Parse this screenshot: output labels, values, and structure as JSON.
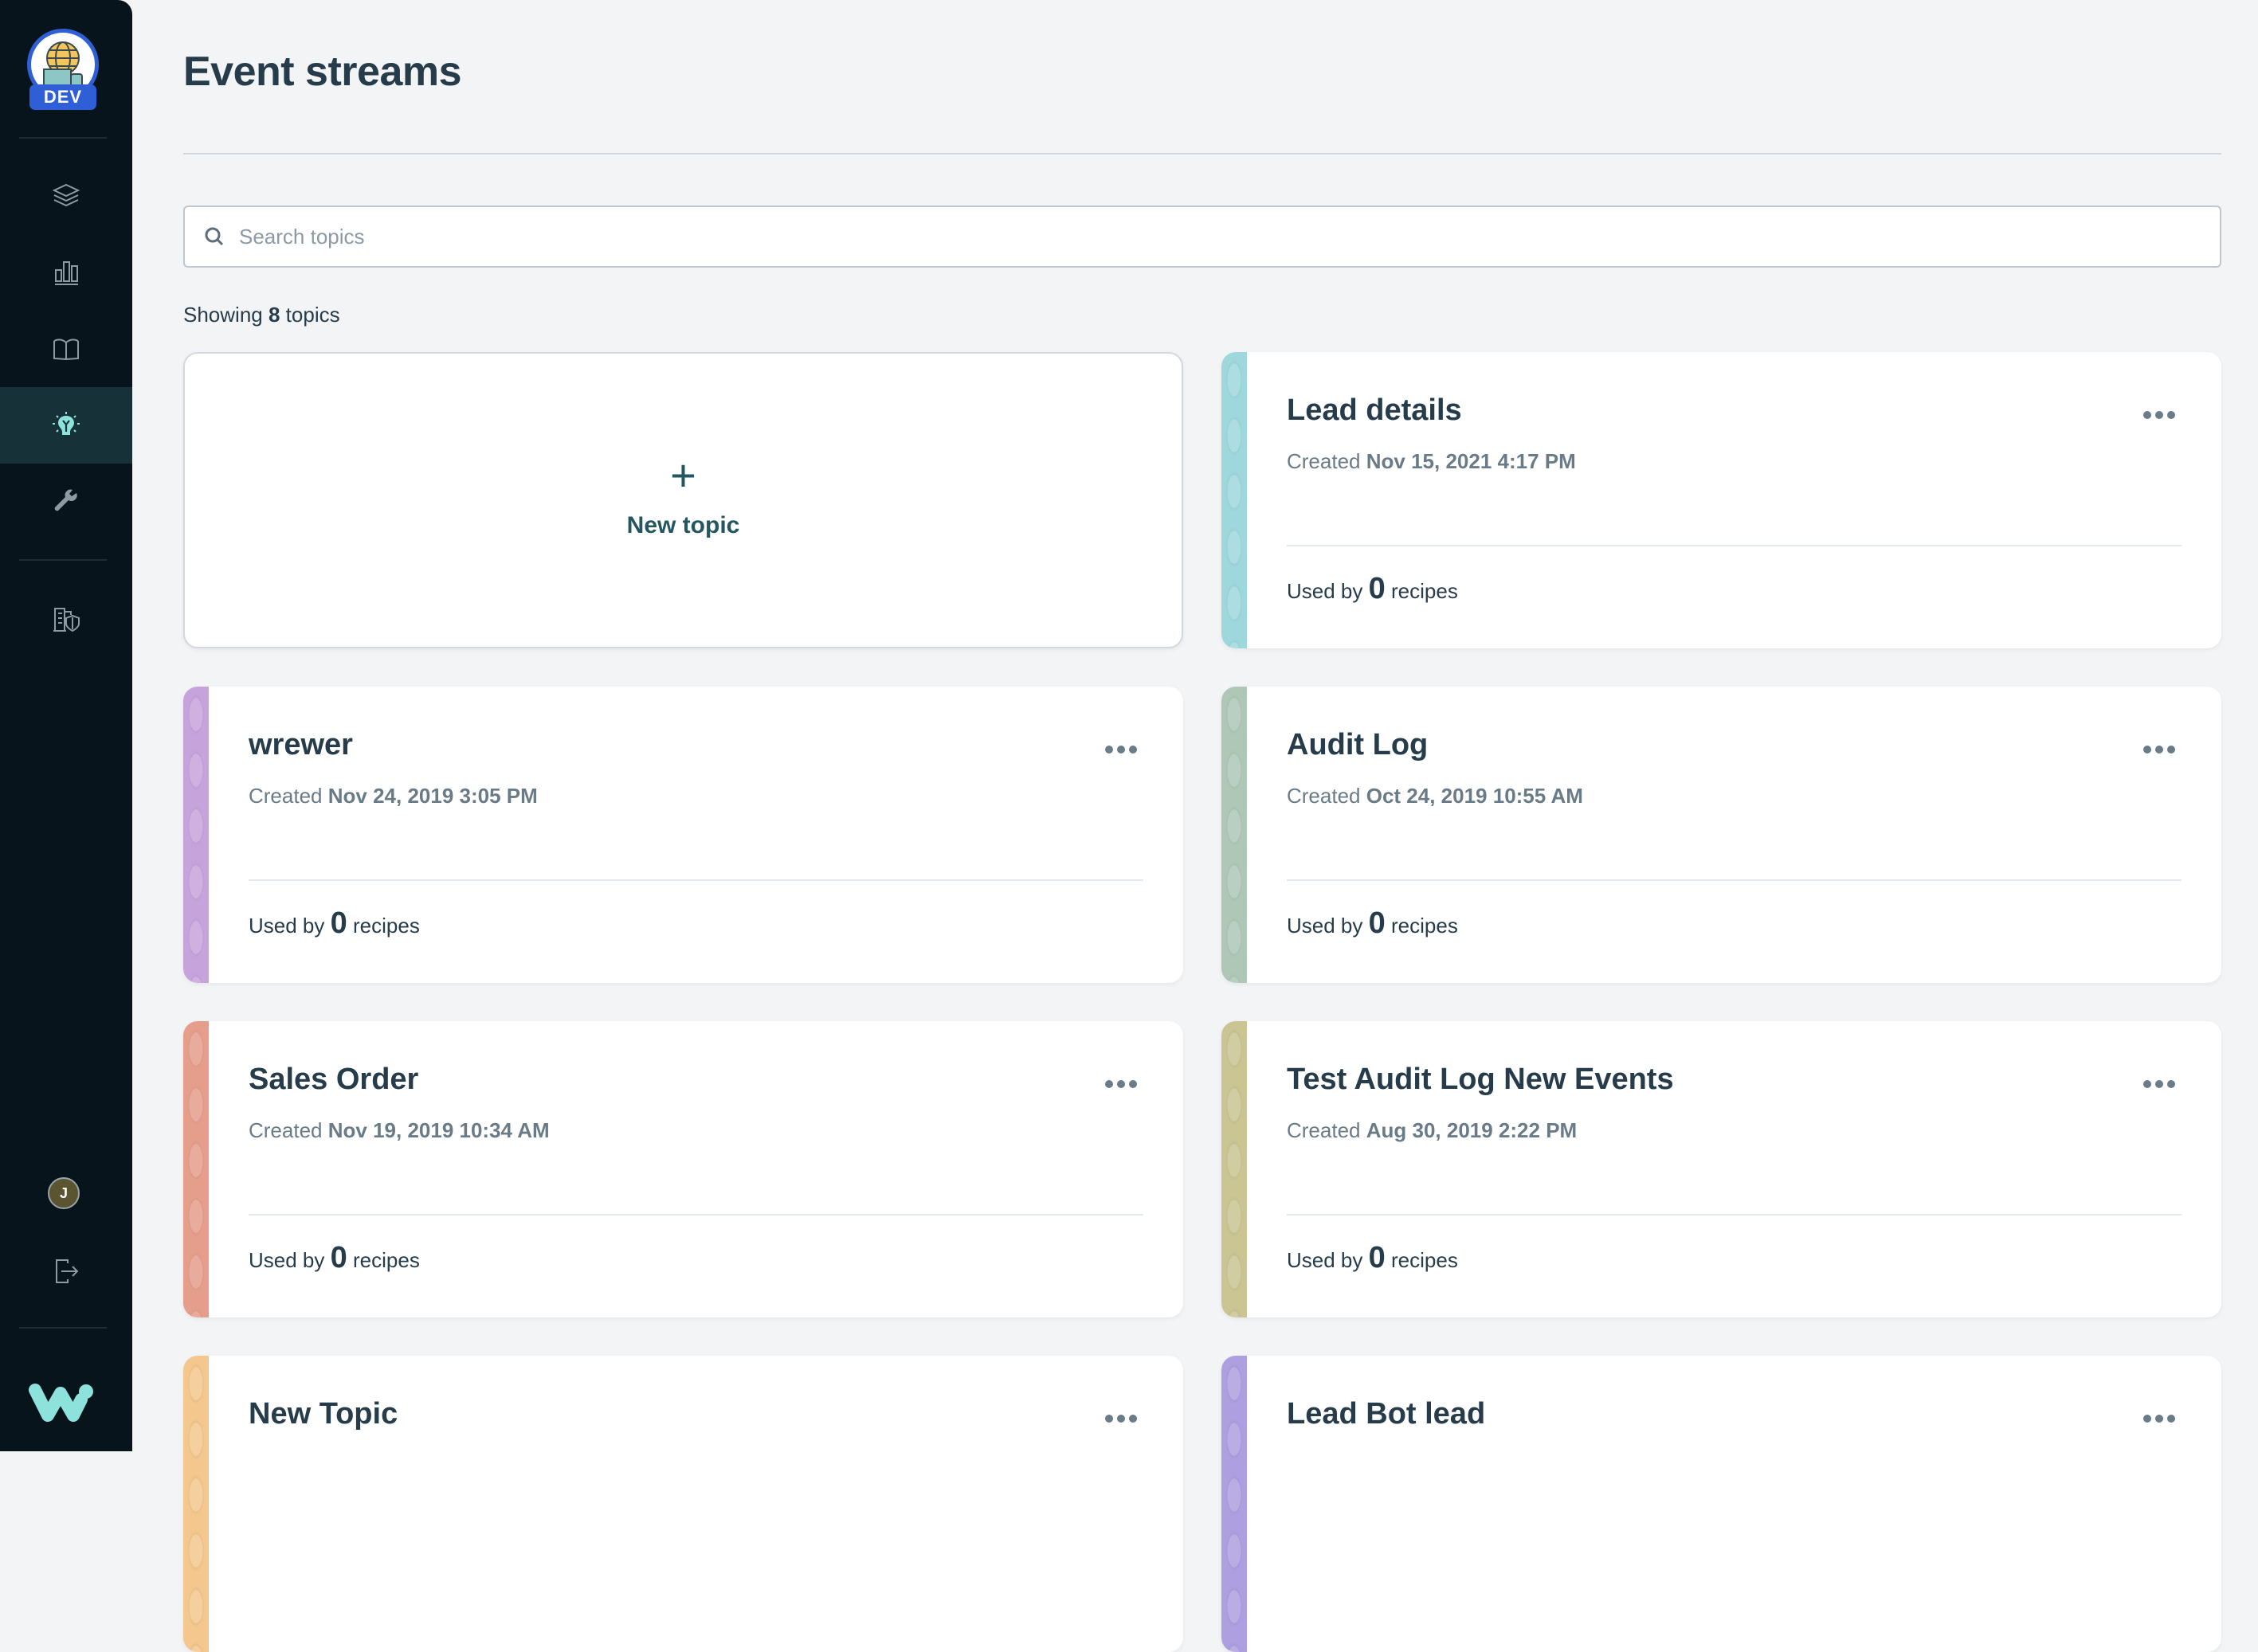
{
  "sidebar": {
    "env_badge": "DEV",
    "nav": [
      {
        "name": "layers",
        "label": "Projects"
      },
      {
        "name": "dashboard",
        "label": "Dashboard"
      },
      {
        "name": "docs",
        "label": "Docs"
      },
      {
        "name": "event-streams",
        "label": "Event streams",
        "active": true
      },
      {
        "name": "tools",
        "label": "Tools"
      },
      {
        "name": "admin",
        "label": "Workspace admin"
      }
    ],
    "user_initial": "J",
    "colors": {
      "bg": "#07141b",
      "active_bg": "#163238",
      "active_icon": "#8de3dc",
      "icon": "#8d9aa3",
      "badge": "#2f5fd6"
    }
  },
  "header": {
    "title": "Event streams"
  },
  "search": {
    "placeholder": "Search topics",
    "value": ""
  },
  "summary": {
    "prefix": "Showing",
    "count": "8",
    "suffix": "topics"
  },
  "new_topic": {
    "plus": "+",
    "label": "New topic"
  },
  "labels": {
    "created": "Created",
    "used_by": "Used by",
    "recipes": "recipes"
  },
  "topics": [
    {
      "title": "Lead details",
      "created": "Nov 15, 2021 4:17 PM",
      "recipes": "0",
      "color": "#9ed8dc"
    },
    {
      "title": "wrewer",
      "created": "Nov 24, 2019 3:05 PM",
      "recipes": "0",
      "color": "#c7a3dc"
    },
    {
      "title": "Audit Log",
      "created": "Oct 24, 2019 10:55 AM",
      "recipes": "0",
      "color": "#aec7b7"
    },
    {
      "title": "Sales Order",
      "created": "Nov 19, 2019 10:34 AM",
      "recipes": "0",
      "color": "#e59e8c"
    },
    {
      "title": "Test Audit Log New Events",
      "created": "Aug 30, 2019 2:22 PM",
      "recipes": "0",
      "color": "#cac593"
    },
    {
      "title": "New Topic",
      "created": "",
      "recipes": "",
      "color": "#f3c78d"
    },
    {
      "title": "Lead Bot lead",
      "created": "",
      "recipes": "",
      "color": "#ad9fe0"
    }
  ]
}
